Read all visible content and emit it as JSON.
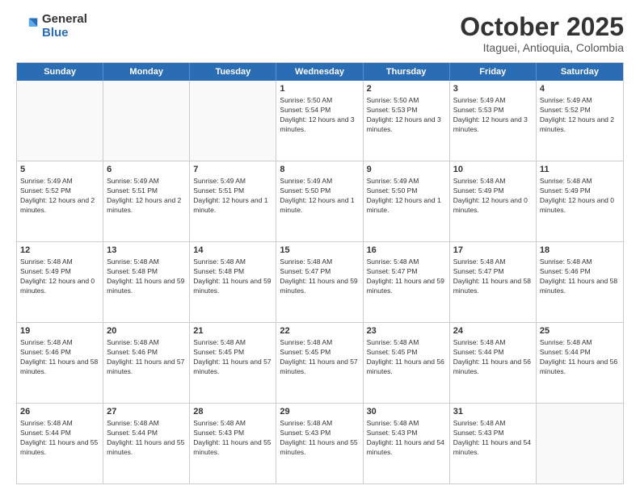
{
  "logo": {
    "general": "General",
    "blue": "Blue"
  },
  "title": "October 2025",
  "subtitle": "Itaguei, Antioquia, Colombia",
  "days": [
    "Sunday",
    "Monday",
    "Tuesday",
    "Wednesday",
    "Thursday",
    "Friday",
    "Saturday"
  ],
  "weeks": [
    [
      {
        "day": "",
        "sunrise": "",
        "sunset": "",
        "daylight": ""
      },
      {
        "day": "",
        "sunrise": "",
        "sunset": "",
        "daylight": ""
      },
      {
        "day": "",
        "sunrise": "",
        "sunset": "",
        "daylight": ""
      },
      {
        "day": "1",
        "sunrise": "Sunrise: 5:50 AM",
        "sunset": "Sunset: 5:54 PM",
        "daylight": "Daylight: 12 hours and 3 minutes."
      },
      {
        "day": "2",
        "sunrise": "Sunrise: 5:50 AM",
        "sunset": "Sunset: 5:53 PM",
        "daylight": "Daylight: 12 hours and 3 minutes."
      },
      {
        "day": "3",
        "sunrise": "Sunrise: 5:49 AM",
        "sunset": "Sunset: 5:53 PM",
        "daylight": "Daylight: 12 hours and 3 minutes."
      },
      {
        "day": "4",
        "sunrise": "Sunrise: 5:49 AM",
        "sunset": "Sunset: 5:52 PM",
        "daylight": "Daylight: 12 hours and 2 minutes."
      }
    ],
    [
      {
        "day": "5",
        "sunrise": "Sunrise: 5:49 AM",
        "sunset": "Sunset: 5:52 PM",
        "daylight": "Daylight: 12 hours and 2 minutes."
      },
      {
        "day": "6",
        "sunrise": "Sunrise: 5:49 AM",
        "sunset": "Sunset: 5:51 PM",
        "daylight": "Daylight: 12 hours and 2 minutes."
      },
      {
        "day": "7",
        "sunrise": "Sunrise: 5:49 AM",
        "sunset": "Sunset: 5:51 PM",
        "daylight": "Daylight: 12 hours and 1 minute."
      },
      {
        "day": "8",
        "sunrise": "Sunrise: 5:49 AM",
        "sunset": "Sunset: 5:50 PM",
        "daylight": "Daylight: 12 hours and 1 minute."
      },
      {
        "day": "9",
        "sunrise": "Sunrise: 5:49 AM",
        "sunset": "Sunset: 5:50 PM",
        "daylight": "Daylight: 12 hours and 1 minute."
      },
      {
        "day": "10",
        "sunrise": "Sunrise: 5:48 AM",
        "sunset": "Sunset: 5:49 PM",
        "daylight": "Daylight: 12 hours and 0 minutes."
      },
      {
        "day": "11",
        "sunrise": "Sunrise: 5:48 AM",
        "sunset": "Sunset: 5:49 PM",
        "daylight": "Daylight: 12 hours and 0 minutes."
      }
    ],
    [
      {
        "day": "12",
        "sunrise": "Sunrise: 5:48 AM",
        "sunset": "Sunset: 5:49 PM",
        "daylight": "Daylight: 12 hours and 0 minutes."
      },
      {
        "day": "13",
        "sunrise": "Sunrise: 5:48 AM",
        "sunset": "Sunset: 5:48 PM",
        "daylight": "Daylight: 11 hours and 59 minutes."
      },
      {
        "day": "14",
        "sunrise": "Sunrise: 5:48 AM",
        "sunset": "Sunset: 5:48 PM",
        "daylight": "Daylight: 11 hours and 59 minutes."
      },
      {
        "day": "15",
        "sunrise": "Sunrise: 5:48 AM",
        "sunset": "Sunset: 5:47 PM",
        "daylight": "Daylight: 11 hours and 59 minutes."
      },
      {
        "day": "16",
        "sunrise": "Sunrise: 5:48 AM",
        "sunset": "Sunset: 5:47 PM",
        "daylight": "Daylight: 11 hours and 59 minutes."
      },
      {
        "day": "17",
        "sunrise": "Sunrise: 5:48 AM",
        "sunset": "Sunset: 5:47 PM",
        "daylight": "Daylight: 11 hours and 58 minutes."
      },
      {
        "day": "18",
        "sunrise": "Sunrise: 5:48 AM",
        "sunset": "Sunset: 5:46 PM",
        "daylight": "Daylight: 11 hours and 58 minutes."
      }
    ],
    [
      {
        "day": "19",
        "sunrise": "Sunrise: 5:48 AM",
        "sunset": "Sunset: 5:46 PM",
        "daylight": "Daylight: 11 hours and 58 minutes."
      },
      {
        "day": "20",
        "sunrise": "Sunrise: 5:48 AM",
        "sunset": "Sunset: 5:46 PM",
        "daylight": "Daylight: 11 hours and 57 minutes."
      },
      {
        "day": "21",
        "sunrise": "Sunrise: 5:48 AM",
        "sunset": "Sunset: 5:45 PM",
        "daylight": "Daylight: 11 hours and 57 minutes."
      },
      {
        "day": "22",
        "sunrise": "Sunrise: 5:48 AM",
        "sunset": "Sunset: 5:45 PM",
        "daylight": "Daylight: 11 hours and 57 minutes."
      },
      {
        "day": "23",
        "sunrise": "Sunrise: 5:48 AM",
        "sunset": "Sunset: 5:45 PM",
        "daylight": "Daylight: 11 hours and 56 minutes."
      },
      {
        "day": "24",
        "sunrise": "Sunrise: 5:48 AM",
        "sunset": "Sunset: 5:44 PM",
        "daylight": "Daylight: 11 hours and 56 minutes."
      },
      {
        "day": "25",
        "sunrise": "Sunrise: 5:48 AM",
        "sunset": "Sunset: 5:44 PM",
        "daylight": "Daylight: 11 hours and 56 minutes."
      }
    ],
    [
      {
        "day": "26",
        "sunrise": "Sunrise: 5:48 AM",
        "sunset": "Sunset: 5:44 PM",
        "daylight": "Daylight: 11 hours and 55 minutes."
      },
      {
        "day": "27",
        "sunrise": "Sunrise: 5:48 AM",
        "sunset": "Sunset: 5:44 PM",
        "daylight": "Daylight: 11 hours and 55 minutes."
      },
      {
        "day": "28",
        "sunrise": "Sunrise: 5:48 AM",
        "sunset": "Sunset: 5:43 PM",
        "daylight": "Daylight: 11 hours and 55 minutes."
      },
      {
        "day": "29",
        "sunrise": "Sunrise: 5:48 AM",
        "sunset": "Sunset: 5:43 PM",
        "daylight": "Daylight: 11 hours and 55 minutes."
      },
      {
        "day": "30",
        "sunrise": "Sunrise: 5:48 AM",
        "sunset": "Sunset: 5:43 PM",
        "daylight": "Daylight: 11 hours and 54 minutes."
      },
      {
        "day": "31",
        "sunrise": "Sunrise: 5:48 AM",
        "sunset": "Sunset: 5:43 PM",
        "daylight": "Daylight: 11 hours and 54 minutes."
      },
      {
        "day": "",
        "sunrise": "",
        "sunset": "",
        "daylight": ""
      }
    ]
  ]
}
